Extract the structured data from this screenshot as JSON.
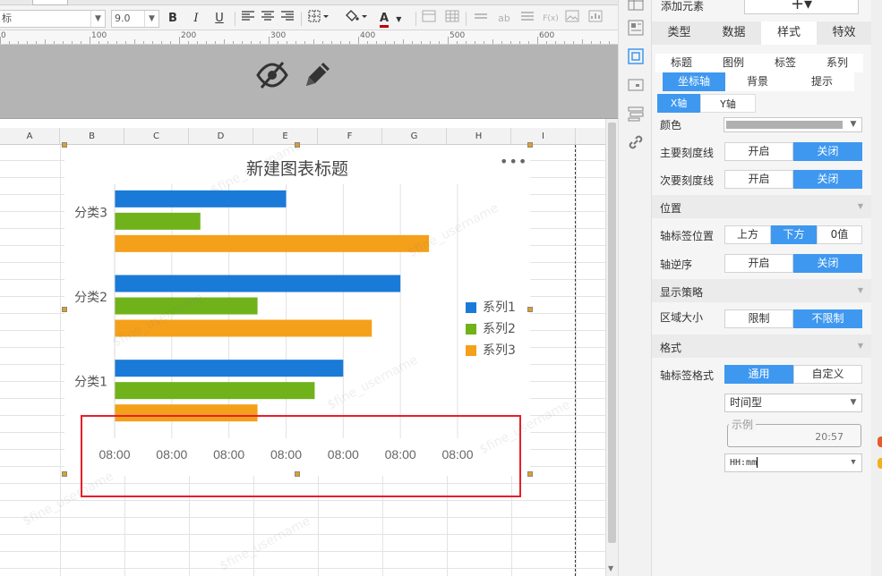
{
  "toolbar": {
    "font_name": "标",
    "font_size": "9.0",
    "bold": "B",
    "italic": "I",
    "underline": "U",
    "text_color_letter": "A",
    "ab_label": "ab",
    "fx_label": "F(x)"
  },
  "ruler": {
    "marks": [
      "0",
      "100",
      "200",
      "300",
      "400",
      "500",
      "600"
    ]
  },
  "sheet": {
    "columns": [
      "A",
      "B",
      "C",
      "D",
      "E",
      "F",
      "G",
      "H",
      "I"
    ]
  },
  "chart_data": {
    "type": "bar",
    "orientation": "horizontal",
    "title": "新建图表标题",
    "categories": [
      "分类3",
      "分类2",
      "分类1"
    ],
    "series": [
      {
        "name": "系列1",
        "color": "#1a7ad8",
        "values": [
          6,
          10,
          8
        ]
      },
      {
        "name": "系列2",
        "color": "#6fb21a",
        "values": [
          3,
          5,
          7
        ]
      },
      {
        "name": "系列3",
        "color": "#f5a01a",
        "values": [
          11,
          9,
          5
        ]
      }
    ],
    "xlim": [
      0,
      12
    ],
    "x_ticks": [
      0,
      2,
      4,
      6,
      8,
      10,
      12
    ],
    "x_tick_labels": [
      "08:00",
      "08:00",
      "08:00",
      "08:00",
      "08:00",
      "08:00",
      "08:00"
    ],
    "grid": true,
    "legend_position": "right"
  },
  "chart": {
    "more_label": "•••"
  },
  "watermark": "$fine_username",
  "panel": {
    "add_element_label": "添加元素",
    "add_button_label": "+▾",
    "main_tabs": [
      "类型",
      "数据",
      "样式",
      "特效"
    ],
    "sub_tabs_row1": [
      "标题",
      "图例",
      "标签",
      "系列"
    ],
    "sub_tabs_row2": [
      "坐标轴",
      "背景",
      "提示"
    ],
    "axis_tabs": [
      "X轴",
      "Y轴"
    ],
    "color_label": "颜色",
    "major_tick_label": "主要刻度线",
    "minor_tick_label": "次要刻度线",
    "on": "开启",
    "off": "关闭",
    "position_section": "位置",
    "label_position_label": "轴标签位置",
    "pos_top": "上方",
    "pos_bottom": "下方",
    "pos_zero": "0值",
    "reverse_label": "轴逆序",
    "display_section": "显示策略",
    "area_size_label": "区域大小",
    "limited": "限制",
    "unlimited": "不限制",
    "format_section": "格式",
    "label_format_label": "轴标签格式",
    "general": "通用",
    "custom": "自定义",
    "type_value": "时间型",
    "example_label": "示例",
    "example_value": "20:57",
    "pattern_value": "HH:mm"
  },
  "colors": {
    "accent": "#3e98f0",
    "highlight_box": "#e81e2a"
  }
}
